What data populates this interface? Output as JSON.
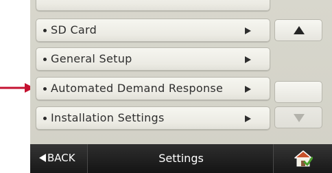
{
  "menu": {
    "items": [
      {
        "label": ""
      },
      {
        "label": "SD Card"
      },
      {
        "label": "General Setup"
      },
      {
        "label": "Automated Demand Response"
      },
      {
        "label": "Installation Settings"
      }
    ]
  },
  "scroll": {
    "up_icon": "triangle-up-icon",
    "down_icon": "triangle-down-icon",
    "down_enabled": false
  },
  "bottom_bar": {
    "back_label": "BACK",
    "title": "Settings",
    "home_icon": "home-icon"
  },
  "colors": {
    "callout_arrow": "#c41230",
    "bottom_bar": "#1e1e1e",
    "home_roof": "#c8502a",
    "home_check": "#4aa02c"
  }
}
